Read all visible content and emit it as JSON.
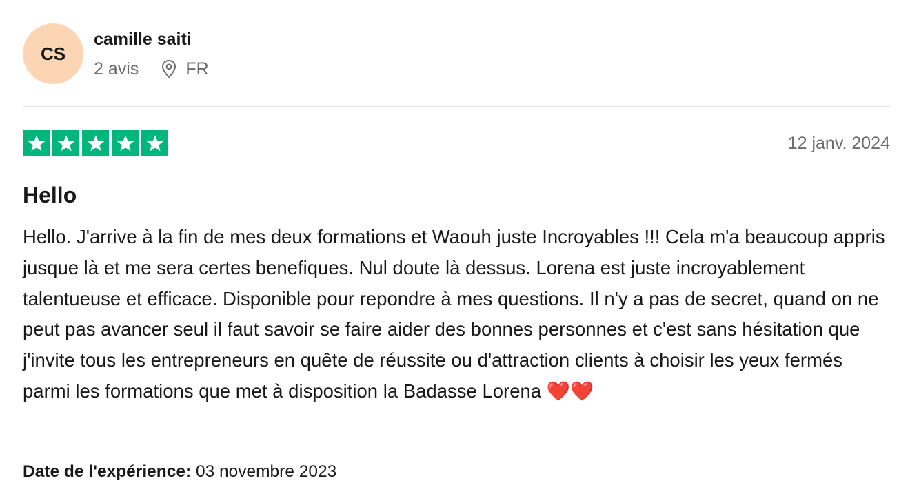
{
  "reviewer": {
    "initials": "CS",
    "name": "camille saiti",
    "review_count": "2 avis",
    "country": "FR",
    "avatar_color": "#fcd6b4"
  },
  "review": {
    "rating": 5,
    "max_rating": 5,
    "star_color": "#00b67a",
    "date": "12 janv. 2024",
    "title": "Hello",
    "body": "Hello. J'arrive à la fin de mes deux formations et Waouh juste Incroyables !!! Cela m'a beaucoup appris jusque là et me sera certes benefiques. Nul doute là dessus. Lorena est juste incroyablement talentueuse et efficace. Disponible pour repondre à mes questions. Il n'y a pas de secret, quand on ne peut pas avancer seul il faut savoir se faire aider des bonnes personnes et c'est sans hésitation que j'invite tous les entrepreneurs en quête de réussite ou d'attraction clients à choisir les yeux fermés parmi les formations que met à disposition la Badasse Lorena ❤️❤️",
    "experience_label": "Date de l'expérience:",
    "experience_date": "03 novembre 2023"
  },
  "icons": {
    "location": "location-pin-icon",
    "star": "star-icon"
  }
}
